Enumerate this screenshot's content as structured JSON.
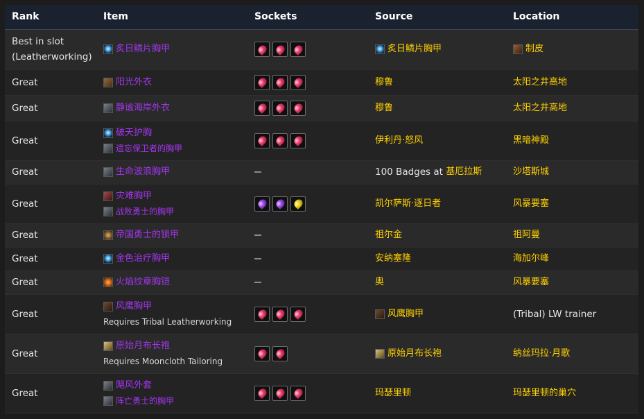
{
  "headers": [
    "Rank",
    "Item",
    "Sockets",
    "Source",
    "Location"
  ],
  "rows": [
    {
      "rank": "Best in slot (Leatherworking)",
      "items": [
        {
          "icon": "i-blue",
          "name": "炙日鳞片胸甲",
          "small": false
        }
      ],
      "sockets": [
        "red",
        "red",
        "red"
      ],
      "source": {
        "icon": "i-blue",
        "text": "炙日鳞片胸甲",
        "style": "gold"
      },
      "location": {
        "icon": "i-leather",
        "text": "制皮",
        "style": "gold"
      }
    },
    {
      "rank": "Great",
      "items": [
        {
          "icon": "i-tan",
          "name": "阳光外衣",
          "small": false
        }
      ],
      "sockets": [
        "red",
        "red",
        "red"
      ],
      "source": {
        "text": "穆鲁",
        "style": "gold"
      },
      "location": {
        "text": "太阳之井高地",
        "style": "gold"
      }
    },
    {
      "rank": "Great",
      "items": [
        {
          "icon": "i-grey",
          "name": "静谧海岸外衣",
          "small": false
        }
      ],
      "sockets": [
        "red",
        "red",
        "red"
      ],
      "source": {
        "text": "穆鲁",
        "style": "gold"
      },
      "location": {
        "text": "太阳之井高地",
        "style": "gold"
      }
    },
    {
      "rank": "Great",
      "items": [
        {
          "icon": "i-blue",
          "name": "破天护胸",
          "small": false
        },
        {
          "icon": "i-grey",
          "name": "遗忘保卫者的胸甲",
          "small": true
        }
      ],
      "sockets": [
        "red",
        "red",
        "red"
      ],
      "source": {
        "text": "伊利丹·怒风",
        "style": "gold"
      },
      "location": {
        "text": "黑暗神殿",
        "style": "gold"
      }
    },
    {
      "rank": "Great",
      "items": [
        {
          "icon": "i-grey",
          "name": "生命波浪胸甲",
          "small": false
        }
      ],
      "sockets": [],
      "source": {
        "prefix": "100 Badges at ",
        "text": "基厄拉斯",
        "style": "gold"
      },
      "location": {
        "text": "沙塔斯城",
        "style": "gold"
      }
    },
    {
      "rank": "Great",
      "items": [
        {
          "icon": "i-red",
          "name": "灾难胸甲",
          "small": false
        },
        {
          "icon": "i-grey",
          "name": "战败勇士的胸甲",
          "small": true
        }
      ],
      "sockets": [
        "purple",
        "purple",
        "yellow"
      ],
      "source": {
        "text": "凯尔萨斯·逐日者",
        "style": "gold"
      },
      "location": {
        "text": "风暴要塞",
        "style": "gold"
      }
    },
    {
      "rank": "Great",
      "items": [
        {
          "icon": "i-ring",
          "name": "帝国勇士的锁甲",
          "small": false
        }
      ],
      "sockets": [],
      "source": {
        "text": "祖尔金",
        "style": "gold"
      },
      "location": {
        "text": "祖阿曼",
        "style": "gold"
      }
    },
    {
      "rank": "Great",
      "items": [
        {
          "icon": "i-blue",
          "name": "金色治疗胸甲",
          "small": false
        }
      ],
      "sockets": [],
      "source": {
        "text": "安纳塞隆",
        "style": "gold"
      },
      "location": {
        "text": "海加尔峰",
        "style": "gold"
      }
    },
    {
      "rank": "Great",
      "items": [
        {
          "icon": "i-orange",
          "name": "火焰纹章胸铠",
          "small": false
        }
      ],
      "sockets": [],
      "source": {
        "text": "奥",
        "style": "gold"
      },
      "location": {
        "text": "风暴要塞",
        "style": "gold"
      }
    },
    {
      "rank": "Great",
      "items": [
        {
          "icon": "i-brown",
          "name": "风鹰胸甲",
          "small": false
        }
      ],
      "note": "Requires Tribal Leatherworking",
      "sockets": [
        "red",
        "red",
        "red"
      ],
      "source": {
        "icon": "i-brown",
        "text": "风鹰胸甲",
        "style": "gold"
      },
      "location": {
        "text": "(Tribal) LW trainer",
        "style": "plain"
      }
    },
    {
      "rank": "Great",
      "items": [
        {
          "icon": "i-straw",
          "name": "原始月布长袍",
          "small": false
        }
      ],
      "note": "Requires Mooncloth Tailoring",
      "sockets": [
        "red",
        "red"
      ],
      "source": {
        "icon": "i-straw",
        "text": "原始月布长袍",
        "style": "gold"
      },
      "location": {
        "text": "纳丝玛拉·月歌",
        "style": "gold"
      }
    },
    {
      "rank": "Great",
      "items": [
        {
          "icon": "i-grey",
          "name": "飓风外套",
          "small": false
        },
        {
          "icon": "i-grey",
          "name": "阵亡勇士的胸甲",
          "small": true
        }
      ],
      "sockets": [
        "red",
        "red",
        "red"
      ],
      "source": {
        "text": "玛瑟里顿",
        "style": "gold"
      },
      "location": {
        "text": "玛瑟里顿的巢穴",
        "style": "gold"
      }
    }
  ],
  "layout": {
    "heights": [
      58,
      37,
      37,
      57,
      34,
      57,
      34,
      34,
      34,
      57,
      57,
      57
    ]
  }
}
